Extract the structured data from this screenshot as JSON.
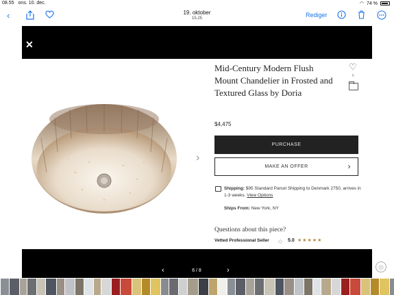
{
  "status_bar": {
    "time": "08.55",
    "date": "ons. 10. dec.",
    "wifi_icon": "wifi-icon",
    "battery": "74 %"
  },
  "toolbar": {
    "title": "19. oktober",
    "subtitle": "15.25",
    "edit_label": "Rediger",
    "icons": [
      "back-chevron-icon",
      "share-icon",
      "heart-icon",
      "info-icon",
      "trash-icon",
      "more-icon"
    ]
  },
  "listing": {
    "close_icon": "close-icon",
    "title": "Mid-Century Modern Flush Mount Chandelier in Frosted and Textured Glass by Doria",
    "price": "$4,475",
    "favorite_count": "6",
    "purchase_label": "PURCHASE",
    "offer_label": "MAKE AN OFFER",
    "shipping_label": "Shipping:",
    "shipping_text": "$95 Standard Parcel Shipping to Denmark 2750, arrives in 1-3 weeks.",
    "shipping_link": "View Options",
    "ships_from_label": "Ships From:",
    "ships_from_value": "New York, NY",
    "questions": "Questions about this piece?",
    "seller_label": "Vetted Professional Seller",
    "rating": "5.0",
    "stars": "★★★★★"
  },
  "pager": {
    "text": "6 / 8"
  },
  "colors": {
    "accent": "#1a73e8",
    "dark": "#222222",
    "star": "#b08a3e"
  }
}
